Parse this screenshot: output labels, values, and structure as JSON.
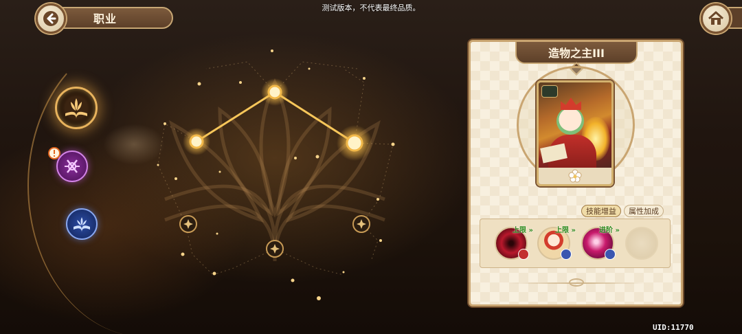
{
  "notice": "测试版本，不代表最终品质。",
  "header": {
    "title": "职业",
    "back_icon": "back-arrow-icon",
    "home_icon": "home-icon"
  },
  "classes": [
    {
      "icon": "book-lotus-icon",
      "state": "selected",
      "color": "#e8b35d"
    },
    {
      "icon": "rune-sigil-icon",
      "state": "normal",
      "color": "#b84ad0",
      "alert": true
    },
    {
      "icon": "blue-book-icon",
      "state": "normal",
      "color": "#3e63c8"
    }
  ],
  "constellation": {
    "lit_nodes": 3,
    "unlit_nodes": 3
  },
  "panel": {
    "title": "造物之主III",
    "tabs": {
      "skill": "技能增益",
      "attribute": "属性加成",
      "active": "skill"
    },
    "effects": [
      {
        "label": "上限",
        "icon": "crimson-vortex-icon",
        "color": "#b8182c"
      },
      {
        "label": "上限",
        "icon": "hero-portrait-icon",
        "color": "#f0d7a8"
      },
      {
        "label": "进阶",
        "icon": "magenta-swirl-icon",
        "color": "#c91a6c"
      },
      {
        "label": "",
        "icon": "empty-slot-icon",
        "color": "#e6d6b6"
      }
    ]
  },
  "uid": "UID:11770"
}
